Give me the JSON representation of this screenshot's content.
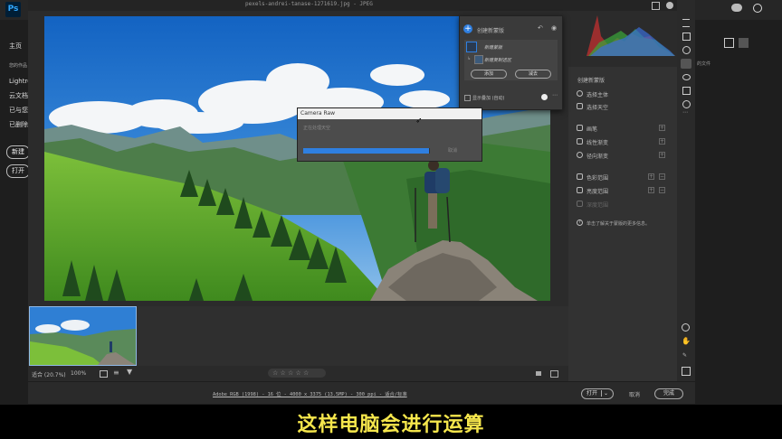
{
  "photoshop": {
    "logo": "Ps",
    "left_items": [
      "主页",
      "您的作品",
      "云文档",
      "Lightro",
      "已与您",
      "已删除"
    ],
    "new_button": "新建",
    "open_button": "打开",
    "right_label": "的文件"
  },
  "camera_raw": {
    "title": "pexels-andrei-tanase-1271619.jpg - JPEG",
    "status_text": "Adobe RGB (1998) - 16 位 - 4000 x 3375 (13.5MP) - 300 ppi - 适合/标准",
    "open_button": "打开",
    "cancel_button": "取消",
    "done_button": "完成",
    "zoom_fit": "适合 (20.7%)",
    "zoom_pct": "100%",
    "stars": "☆ ☆ ☆ ☆ ☆"
  },
  "mask_popup": {
    "header": "创建新蒙版",
    "mask_label": "新建蒙版",
    "mask_sub_label": "新建复制选区",
    "add_button": "添加",
    "subtract_button": "减去",
    "overlay_label": "显示叠加 (自动)"
  },
  "progress_dialog": {
    "title": "Camera Raw",
    "message": "正在处理天空",
    "cancel_button": "取消",
    "progress": 0.99
  },
  "right_panel": {
    "create_mask": "创建新蒙版",
    "select_subject": "选择主体",
    "select_sky": "选择天空",
    "brush": "画笔",
    "linear_gradient": "线性渐变",
    "radial_gradient": "径向渐变",
    "color_range": "色彩范围",
    "luminance_range": "亮度范围",
    "depth_range": "深度范围",
    "help": "单击了解关于蒙版的更多信息。"
  },
  "subtitle": "这样电脑会进行运算",
  "colors": {
    "accent": "#2f7fe0",
    "subtitle": "#f5e64c"
  }
}
